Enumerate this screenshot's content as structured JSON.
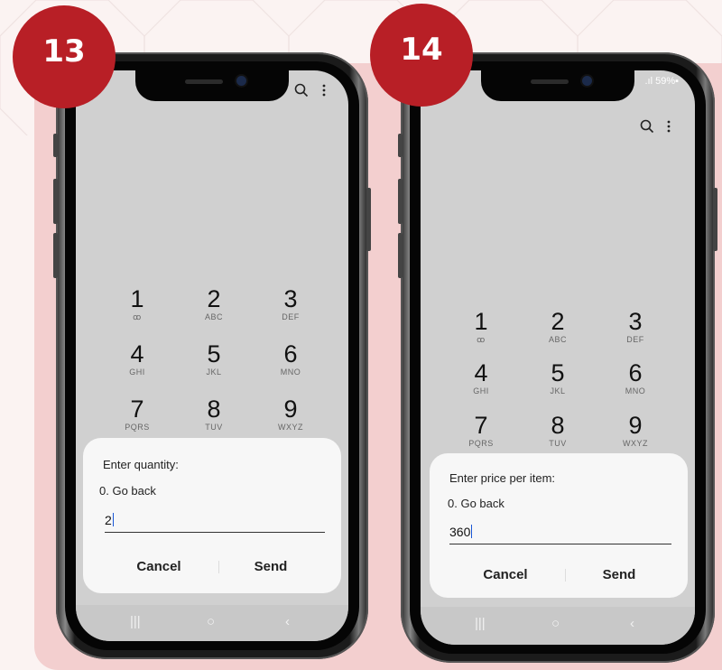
{
  "badges": [
    "13",
    "14"
  ],
  "phones": [
    {
      "status": {
        "left": "",
        "right": ""
      },
      "top_icons": {
        "search": "search-icon",
        "more": "more-vert-icon"
      },
      "keys": [
        {
          "digit": "1",
          "letters": "ꝏ"
        },
        {
          "digit": "2",
          "letters": "ABC"
        },
        {
          "digit": "3",
          "letters": "DEF"
        },
        {
          "digit": "4",
          "letters": "GHI"
        },
        {
          "digit": "5",
          "letters": "JKL"
        },
        {
          "digit": "6",
          "letters": "MNO"
        },
        {
          "digit": "7",
          "letters": "PQRS"
        },
        {
          "digit": "8",
          "letters": "TUV"
        },
        {
          "digit": "9",
          "letters": "WXYZ"
        }
      ],
      "dialog": {
        "title": "Enter quantity:",
        "option": "0. Go back",
        "input_value": "2",
        "cancel": "Cancel",
        "send": "Send"
      }
    },
    {
      "status": {
        "left": "▣ ◎",
        "right": ".ıl 59%▪"
      },
      "top_icons": {
        "search": "search-icon",
        "more": "more-vert-icon"
      },
      "keys": [
        {
          "digit": "1",
          "letters": "ꝏ"
        },
        {
          "digit": "2",
          "letters": "ABC"
        },
        {
          "digit": "3",
          "letters": "DEF"
        },
        {
          "digit": "4",
          "letters": "GHI"
        },
        {
          "digit": "5",
          "letters": "JKL"
        },
        {
          "digit": "6",
          "letters": "MNO"
        },
        {
          "digit": "7",
          "letters": "PQRS"
        },
        {
          "digit": "8",
          "letters": "TUV"
        },
        {
          "digit": "9",
          "letters": "WXYZ"
        }
      ],
      "dialog": {
        "title": "Enter price per item:",
        "option": "0. Go back",
        "input_value": "360",
        "cancel": "Cancel",
        "send": "Send"
      }
    }
  ],
  "nav_icons": {
    "recents": "|||",
    "home": "○",
    "back": "‹"
  },
  "colors": {
    "badge": "#b81f26",
    "panel": "#f3cfcf",
    "screen": "#d0d0d0",
    "caret": "#1a57d6"
  }
}
